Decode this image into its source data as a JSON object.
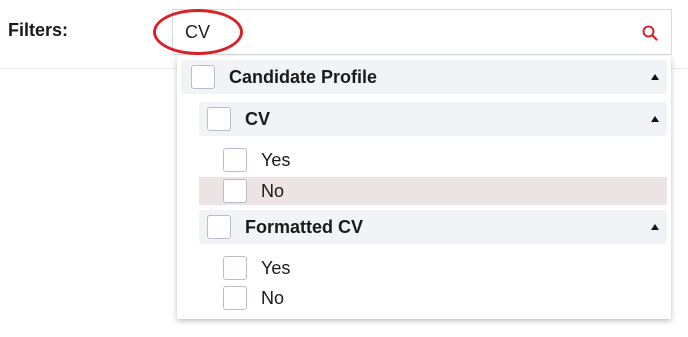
{
  "filters": {
    "label": "Filters:",
    "search_value": "CV",
    "search_icon": "search-icon",
    "accent_color": "#d8222a"
  },
  "dropdown": {
    "group": {
      "label": "Candidate Profile",
      "expanded": true,
      "subgroups": [
        {
          "label": "CV",
          "expanded": true,
          "options": [
            {
              "label": "Yes"
            },
            {
              "label": "No",
              "hovered": true
            }
          ]
        },
        {
          "label": "Formatted CV",
          "expanded": true,
          "options": [
            {
              "label": "Yes"
            },
            {
              "label": "No"
            }
          ]
        }
      ]
    }
  }
}
